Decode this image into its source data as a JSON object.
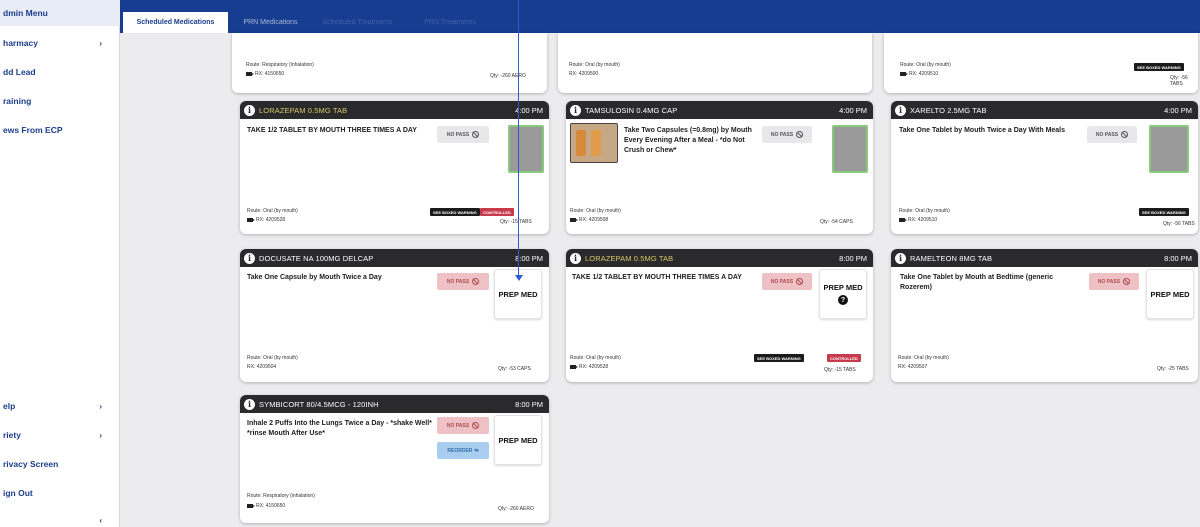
{
  "sidebar": {
    "items": [
      {
        "label": "dmin Menu",
        "chevron": ""
      },
      {
        "label": "harmacy",
        "chevron": "›"
      },
      {
        "label": "dd Lead",
        "chevron": ""
      },
      {
        "label": "raining",
        "chevron": ""
      },
      {
        "label": "ews From ECP",
        "chevron": ""
      }
    ],
    "bottom_items": [
      {
        "label": "elp",
        "chevron": "›"
      },
      {
        "label": "riety",
        "chevron": "›"
      },
      {
        "label": "rivacy Screen",
        "chevron": ""
      },
      {
        "label": "ign Out",
        "chevron": ""
      },
      {
        "label": "",
        "chevron": "‹"
      }
    ]
  },
  "tabs": [
    {
      "label": "Scheduled Medications",
      "active": true
    },
    {
      "label": "PRN Medications",
      "active": false
    },
    {
      "label": "Scheduled Treatments",
      "active": false
    },
    {
      "label": "PRN Treatments",
      "active": false
    }
  ],
  "top_cards": [
    {
      "route": "Route: Respiratory (inhalation)",
      "rx": "RX: 4150650",
      "qty": "Qty: -260 AERO",
      "badge": ""
    },
    {
      "route": "Route: Oral (by mouth)",
      "rx": "RX: 4209500",
      "qty": "",
      "badge": ""
    },
    {
      "route": "Route: Oral (by mouth)",
      "rx": "RX: 4209510",
      "qty": "Qty: -56 TABS",
      "badge": "SEE BOXED WARNING"
    }
  ],
  "cards": [
    {
      "name": "LORAZEPAM 0.5MG TAB",
      "time": "4:00 PM",
      "sig": "TAKE 1/2 TABLET BY MOUTH THREE TIMES A DAY",
      "no_pass": "NO PASS",
      "route": "Route: Oral (by mouth)",
      "rx": "RX: 4209528",
      "qty": "Qty: -15 TABS",
      "badge1": "SEE BOXED WARNING",
      "badge2": "CONTROLLED"
    },
    {
      "name": "TAMSULOSIN 0.4MG CAP",
      "time": "4:00 PM",
      "sig": "Take Two Capsules (=0.8mg) by Mouth Every Evening After a Meal - *do Not Crush or Chew*",
      "no_pass": "NO PASS",
      "route": "Route: Oral (by mouth)",
      "rx": "RX: 4209508",
      "qty": "Qty: -54 CAPS"
    },
    {
      "name": "XARELTO 2.5MG TAB",
      "time": "4:00 PM",
      "sig": "Take One Tablet by Mouth Twice a Day With Meals",
      "no_pass": "NO PASS",
      "route": "Route: Oral (by mouth)",
      "rx": "RX: 4209510",
      "qty": "Qty: -56 TABS",
      "badge1": "SEE BOXED WARNING"
    },
    {
      "name": "DOCUSATE NA 100MG DELCAP",
      "time": "8:00 PM",
      "sig": "Take One Capsule by Mouth Twice a Day",
      "no_pass": "NO PASS",
      "prep": "PREP MED",
      "route": "Route: Oral (by mouth)",
      "rx": "RX: 4209504",
      "qty": "Qty: -53 CAPS"
    },
    {
      "name": "LORAZEPAM 0.5MG TAB",
      "time": "8:00 PM",
      "sig": "TAKE 1/2 TABLET BY MOUTH THREE TIMES A DAY",
      "no_pass": "NO PASS",
      "prep": "PREP MED",
      "route": "Route: Oral (by mouth)",
      "rx": "RX: 4209528",
      "qty": "Qty: -15 TABS",
      "badge1": "SEE BOXED WARNING",
      "badge2": "CONTROLLED"
    },
    {
      "name": "RAMELTEON 8MG TAB",
      "time": "8:00 PM",
      "sig": "Take One Tablet by Mouth at Bedtime (generic Rozerem)",
      "no_pass": "NO PASS",
      "prep": "PREP MED",
      "route": "Route: Oral (by mouth)",
      "rx": "RX: 4209507",
      "qty": "Qty: -25 TABS"
    },
    {
      "name": "SYMBICORT 80/4.5MCG - 120INH",
      "time": "8:00 PM",
      "sig": "Inhale 2 Puffs Into the Lungs Twice a Day - *shake Well* *rinse Mouth After Use*",
      "no_pass": "NO PASS",
      "reorder": "REORDER",
      "prep": "PREP MED",
      "route": "Route: Respiratory (inhalation)",
      "rx": "RX: 4150650",
      "qty": "Qty: -260 AERO"
    }
  ],
  "colors": {
    "nav": "#163d8f",
    "header": "#2a2a2c",
    "no_pass": "#eec1c4",
    "controlled": "#c73b4c",
    "annotation_arrow": "#2c5bd4"
  }
}
